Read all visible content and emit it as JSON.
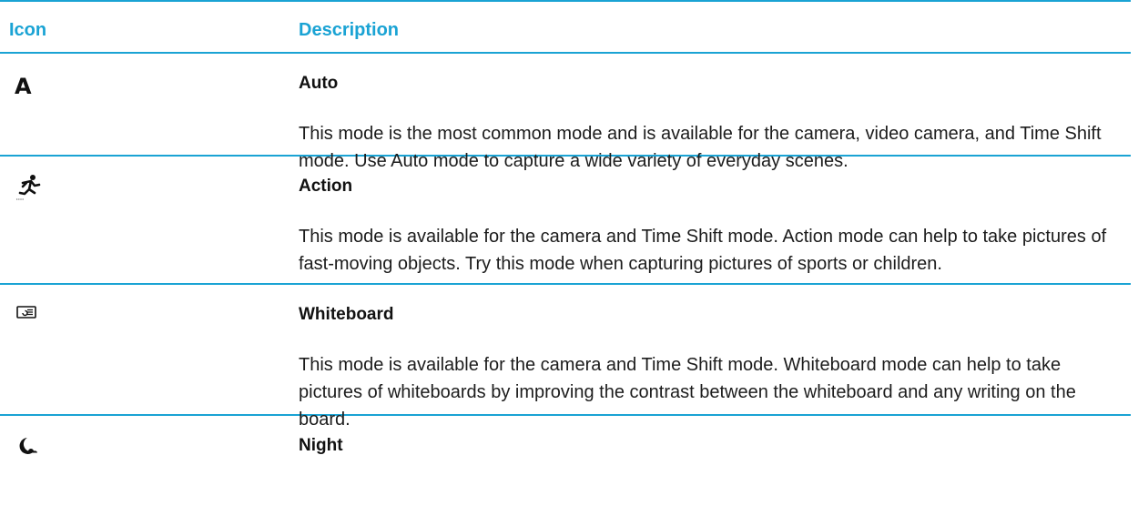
{
  "table": {
    "headers": {
      "icon": "Icon",
      "description": "Description"
    },
    "rows": [
      {
        "icon": "auto-letter-icon",
        "icon_glyph": "A",
        "title": "Auto",
        "description": "This mode is the most common mode and is available for the camera, video camera, and Time Shift mode. Use Auto mode to capture a wide variety of everyday scenes."
      },
      {
        "icon": "running-person-icon",
        "title": "Action",
        "description": "This mode is available for the camera and Time Shift mode. Action mode can help to take pictures of fast-moving objects. Try this mode when capturing pictures of sports or children."
      },
      {
        "icon": "whiteboard-icon",
        "title": "Whiteboard",
        "description": "This mode is available for the camera and Time Shift mode. Whiteboard mode can help to take pictures of whiteboards by improving the contrast between the whiteboard and any writing on the board."
      },
      {
        "icon": "night-moon-icon",
        "title": "Night",
        "description": ""
      }
    ]
  },
  "colors": {
    "accent": "#1aa3d4",
    "text": "#1a1a1a"
  }
}
